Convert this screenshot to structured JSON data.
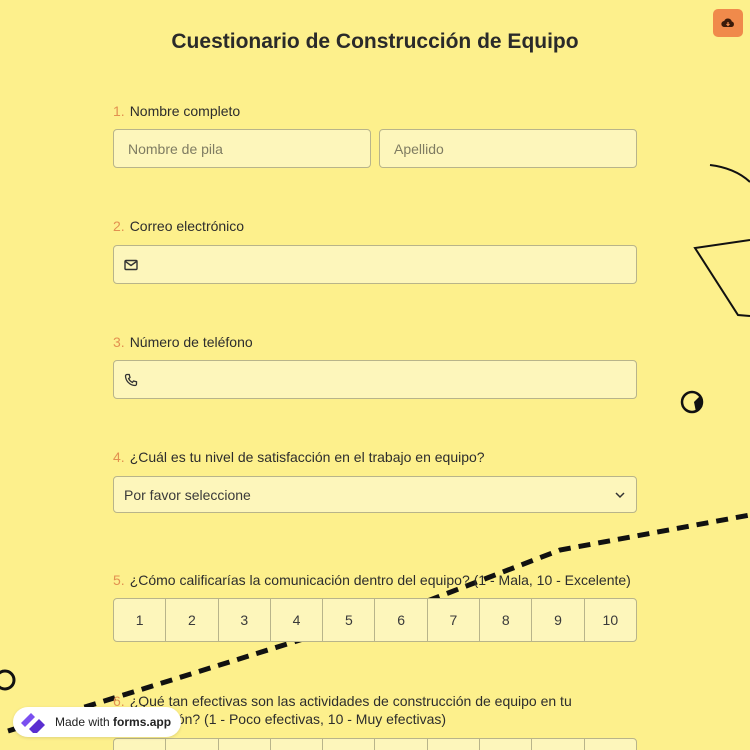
{
  "form": {
    "title": "Cuestionario de Construcción de Equipo"
  },
  "questions": [
    {
      "number": "1.",
      "label": "Nombre completo",
      "first_placeholder": "Nombre de pila",
      "last_placeholder": "Apellido"
    },
    {
      "number": "2.",
      "label": "Correo electrónico",
      "icon": "envelope-icon"
    },
    {
      "number": "3.",
      "label": "Número de teléfono",
      "icon": "phone-icon"
    },
    {
      "number": "4.",
      "label": "¿Cuál es tu nivel de satisfacción en el trabajo en equipo?",
      "select_value": "Por favor seleccione"
    },
    {
      "number": "5.",
      "label": "¿Cómo calificarías la comunicación dentro del equipo? (1 - Mala, 10 - Excelente)",
      "options": [
        "1",
        "2",
        "3",
        "4",
        "5",
        "6",
        "7",
        "8",
        "9",
        "10"
      ]
    },
    {
      "number": "6.",
      "label_line1": "¿Qué tan efectivas son las actividades de construcción de equipo en tu",
      "label_line2": "organización? (1 - Poco efectivas, 10 - Muy efectivas)"
    }
  ],
  "badge": {
    "prefix": "Made with ",
    "brand": "forms.app"
  },
  "colors": {
    "background": "#fdf08c",
    "field": "#fdf6bb",
    "accent_number": "#e29150",
    "cloud_button": "#f08a4b"
  }
}
